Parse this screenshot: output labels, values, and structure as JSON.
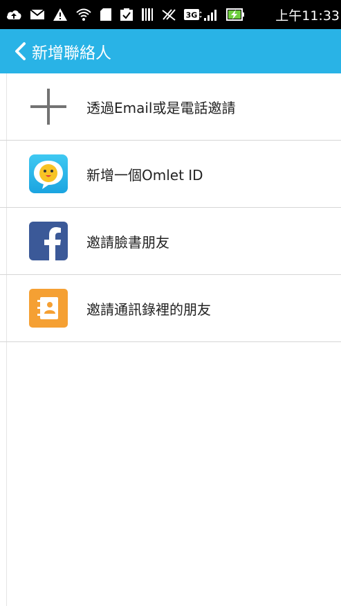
{
  "status_bar": {
    "icons": [
      "cloud-upload-icon",
      "mail-icon",
      "warning-icon",
      "wifi-icon",
      "sd-card-icon",
      "clipboard-check-icon",
      "barcode-icon",
      "no-sync-icon",
      "3g-icon",
      "signal-icon",
      "battery-charging-icon"
    ],
    "network_label": "3G",
    "time": "上午11:33"
  },
  "app_bar": {
    "back_icon": "chevron-left-icon",
    "title": "新增聯絡人"
  },
  "list": {
    "items": [
      {
        "label": "透過Email或是電話邀請",
        "icon": "plus-icon"
      },
      {
        "label": "新增一個Omlet ID",
        "icon": "omlet-icon",
        "color": "#29b3e6"
      },
      {
        "label": "邀請臉書朋友",
        "icon": "facebook-icon",
        "color": "#3b5998"
      },
      {
        "label": "邀請通訊錄裡的朋友",
        "icon": "contacts-icon",
        "color": "#f5a033"
      }
    ]
  }
}
